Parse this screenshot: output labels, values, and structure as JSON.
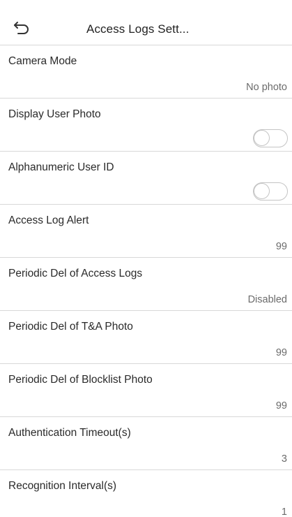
{
  "header": {
    "title": "Access Logs Sett...",
    "back_icon": "back-arrow-icon"
  },
  "settings": [
    {
      "label": "Camera Mode",
      "value": "No photo",
      "type": "value"
    },
    {
      "label": "Display User Photo",
      "value": "",
      "type": "toggle",
      "state": "off"
    },
    {
      "label": "Alphanumeric User ID",
      "value": "",
      "type": "toggle",
      "state": "off"
    },
    {
      "label": "Access Log Alert",
      "value": "99",
      "type": "value"
    },
    {
      "label": "Periodic Del of Access Logs",
      "value": "Disabled",
      "type": "value"
    },
    {
      "label": "Periodic Del of T&A Photo",
      "value": "99",
      "type": "value"
    },
    {
      "label": "Periodic Del of Blocklist Photo",
      "value": "99",
      "type": "value"
    },
    {
      "label": "Authentication Timeout(s)",
      "value": "3",
      "type": "value"
    },
    {
      "label": "Recognition Interval(s)",
      "value": "1",
      "type": "value"
    }
  ],
  "colors": {
    "divider": "#d8d8d8",
    "label": "#2a2a2a",
    "value": "#6b6b6b",
    "toggle_off": "#c4c4c4"
  }
}
